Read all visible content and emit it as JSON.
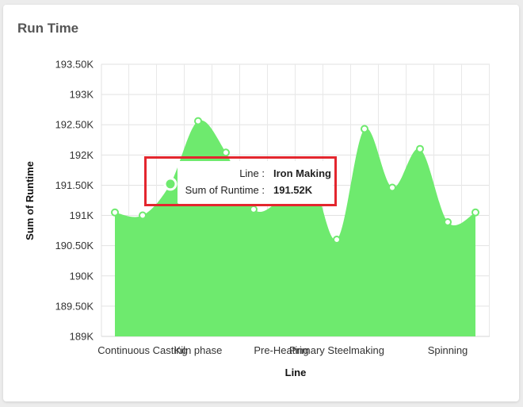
{
  "card": {
    "title": "Run Time"
  },
  "chart_data": {
    "type": "area",
    "xlabel": "Line",
    "ylabel": "Sum of Runtime",
    "ylim": [
      189000,
      193500
    ],
    "yticks": [
      {
        "value": 189000,
        "label": "189K"
      },
      {
        "value": 189500,
        "label": "189.50K"
      },
      {
        "value": 190000,
        "label": "190K"
      },
      {
        "value": 190500,
        "label": "190.50K"
      },
      {
        "value": 191000,
        "label": "191K"
      },
      {
        "value": 191500,
        "label": "191.50K"
      },
      {
        "value": 192000,
        "label": "192K"
      },
      {
        "value": 192500,
        "label": "192.50K"
      },
      {
        "value": 193000,
        "label": "193K"
      },
      {
        "value": 193500,
        "label": "193.50K"
      }
    ],
    "category_labels": [
      {
        "index": 1,
        "label": "Continuous Casting"
      },
      {
        "index": 3,
        "label": "Kiln phase"
      },
      {
        "index": 6,
        "label": "Pre-Heating"
      },
      {
        "index": 8,
        "label": "Primary Steelmaking"
      },
      {
        "index": 12,
        "label": "Spinning"
      }
    ],
    "series": [
      {
        "values": [
          191050,
          191000,
          191520,
          192560,
          192040,
          191100,
          191280,
          191750,
          190600,
          192430,
          191460,
          192100,
          190890,
          191050
        ],
        "color": "#6eea6e"
      }
    ],
    "grid": true,
    "highlighted_index": 2
  },
  "tooltip": {
    "line_label": "Line :",
    "line_value": "Iron Making",
    "runtime_label": "Sum of Runtime :",
    "runtime_value": "191.52K"
  },
  "colors": {
    "area": "#6eea6e",
    "highlight_box": "#e3262e"
  }
}
